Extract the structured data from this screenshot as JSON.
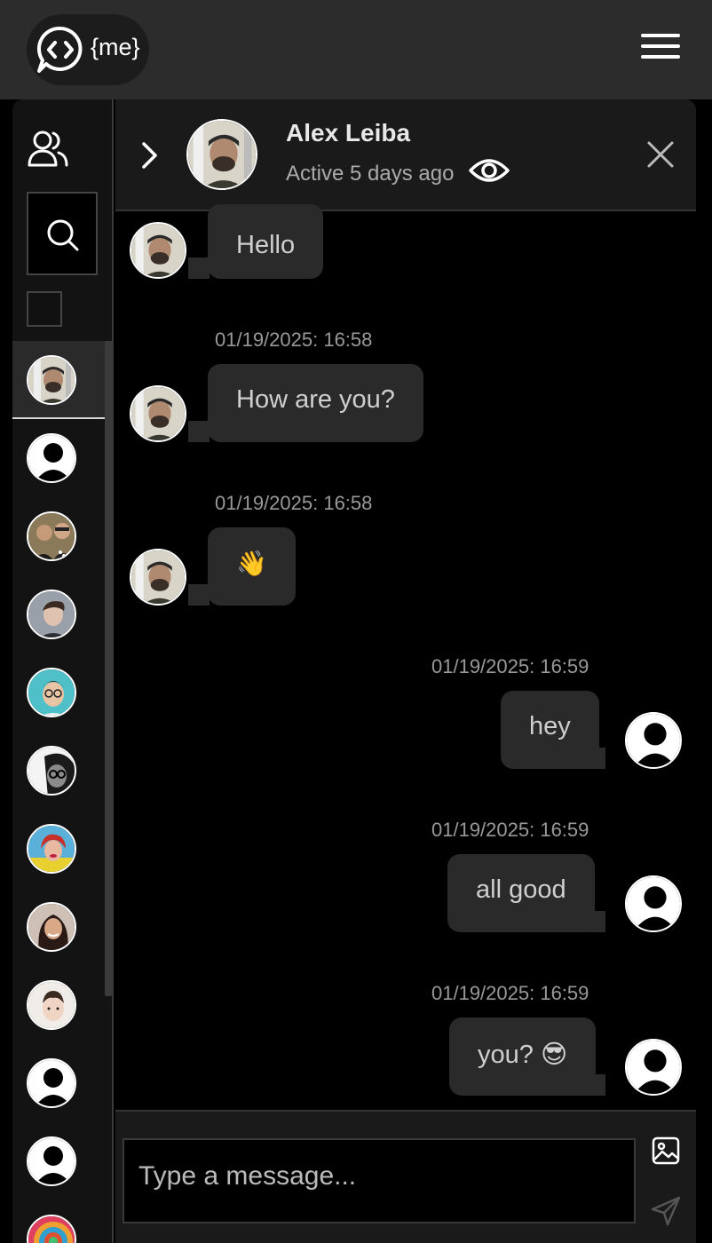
{
  "app": {
    "logo_text": "{me}",
    "icons": {
      "logo": "chat-code-icon",
      "menu": "hamburger-menu-icon"
    }
  },
  "sidebar": {
    "icons": {
      "people": "people-icon",
      "search": "search-icon"
    },
    "contacts": [
      {
        "avatar": "photo-man-selfie",
        "active": true
      },
      {
        "avatar": "default-user"
      },
      {
        "avatar": "photo-two-men"
      },
      {
        "avatar": "photo-young-man-grey"
      },
      {
        "avatar": "photo-man-glasses-teal"
      },
      {
        "avatar": "photo-woman-glasses-bw"
      },
      {
        "avatar": "photo-woman-red-hair-yellow"
      },
      {
        "avatar": "photo-woman-dark-hair"
      },
      {
        "avatar": "photo-child"
      },
      {
        "avatar": "default-user"
      },
      {
        "avatar": "default-user"
      },
      {
        "avatar": "photo-colorful-swirl"
      }
    ]
  },
  "chat": {
    "header": {
      "name": "Alex Leiba",
      "status": "Active 5 days ago",
      "icons": {
        "back": "chevron-right-icon",
        "visibility": "eye-icon",
        "close": "close-icon"
      }
    },
    "messages": [
      {
        "side": "left",
        "text": "Hello",
        "timestamp": ""
      },
      {
        "side": "left",
        "text": "How are you?",
        "timestamp": "01/19/2025: 16:58"
      },
      {
        "side": "left",
        "text": "👋",
        "timestamp": "01/19/2025: 16:58"
      },
      {
        "side": "right",
        "text": "hey",
        "timestamp": "01/19/2025: 16:59"
      },
      {
        "side": "right",
        "text": "all good",
        "timestamp": "01/19/2025: 16:59"
      },
      {
        "side": "right",
        "text": "you? 😎",
        "timestamp": "01/19/2025: 16:59"
      }
    ],
    "composer": {
      "placeholder": "Type a message...",
      "icons": {
        "attach": "image-icon",
        "send": "send-icon"
      }
    }
  },
  "colors": {
    "topbar": "#2c2c2c",
    "panel": "#1a1a1a",
    "bubble": "#2a2a2a",
    "background": "#000000"
  }
}
